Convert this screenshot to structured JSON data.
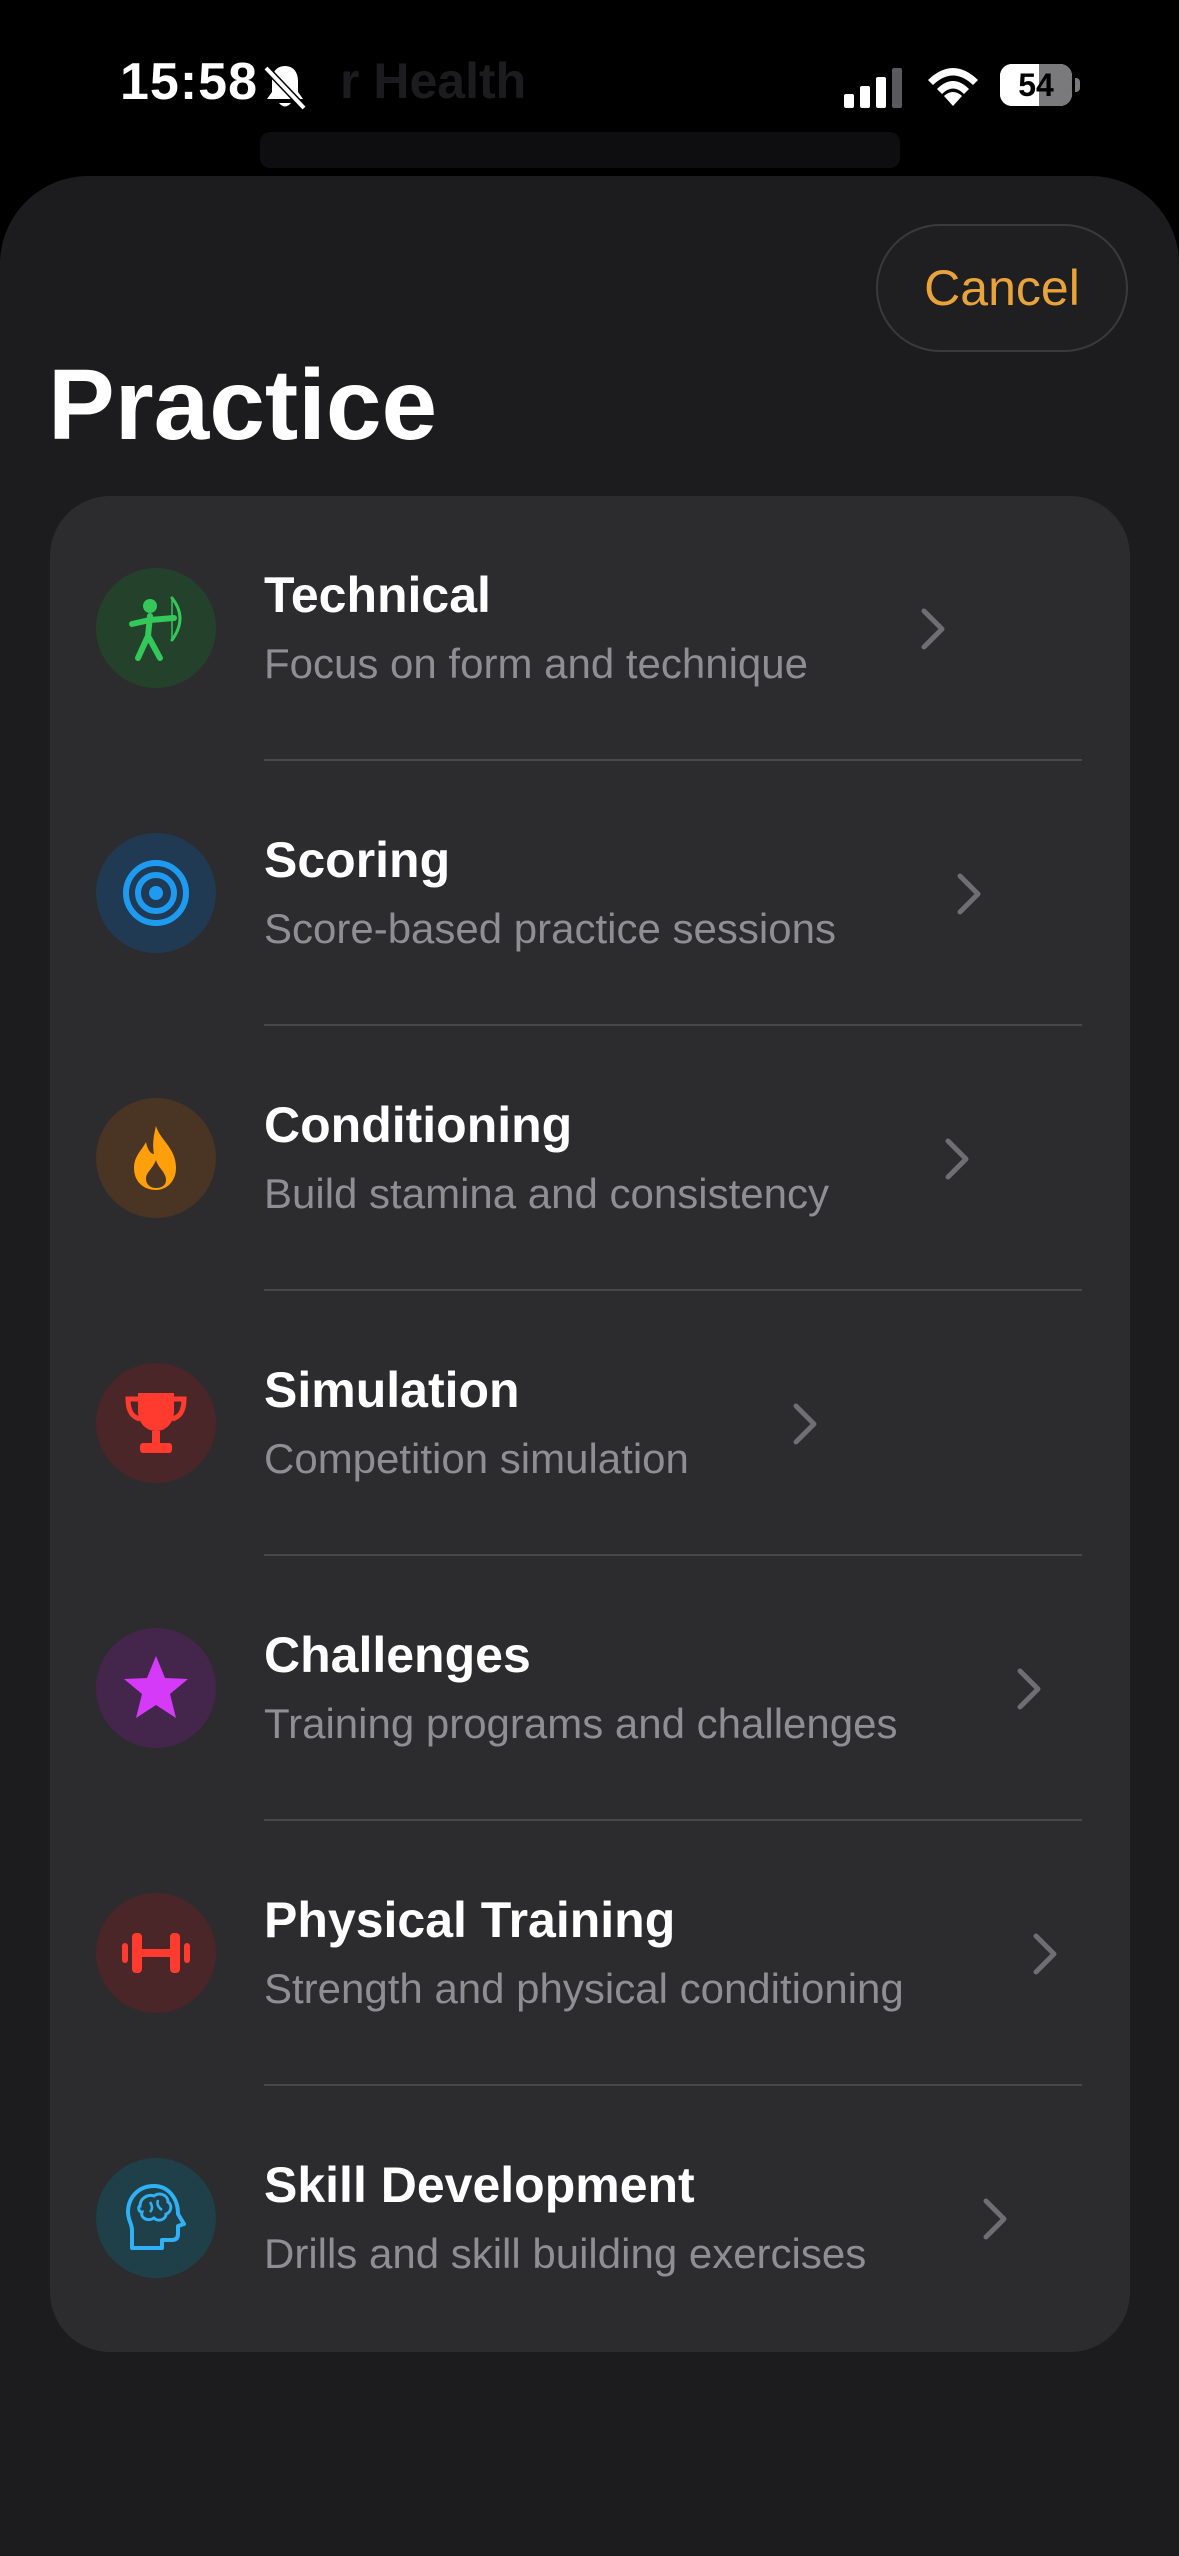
{
  "status_bar": {
    "time": "15:58",
    "battery_percent": 54,
    "battery_label": "54",
    "silent_mode": true
  },
  "background_page": {
    "title_fragment": "r Health"
  },
  "sheet": {
    "cancel_label": "Cancel",
    "title": "Practice",
    "accent_color": "#e8a33a",
    "items": [
      {
        "title": "Technical",
        "subtitle": "Focus on form and technique",
        "icon": "archer-icon",
        "icon_color": "#34c759",
        "icon_bg": "#24412c"
      },
      {
        "title": "Scoring",
        "subtitle": "Score-based practice sessions",
        "icon": "target-icon",
        "icon_color": "#1e9bf0",
        "icon_bg": "#1f3a52"
      },
      {
        "title": "Conditioning",
        "subtitle": "Build stamina and consistency",
        "icon": "flame-icon",
        "icon_color": "#ff9f0a",
        "icon_bg": "#4a3424"
      },
      {
        "title": "Simulation",
        "subtitle": "Competition simulation",
        "icon": "trophy-icon",
        "icon_color": "#ff3b30",
        "icon_bg": "#4a2628"
      },
      {
        "title": "Challenges",
        "subtitle": "Training programs and challenges",
        "icon": "star-icon",
        "icon_color": "#d63af9",
        "icon_bg": "#44264d"
      },
      {
        "title": "Physical Training",
        "subtitle": "Strength and physical conditioning",
        "icon": "dumbbell-icon",
        "icon_color": "#ff3b30",
        "icon_bg": "#4a2628"
      },
      {
        "title": "Skill Development",
        "subtitle": "Drills and skill building exercises",
        "icon": "brain-head-icon",
        "icon_color": "#30b0f5",
        "icon_bg": "#1f4048"
      }
    ]
  }
}
